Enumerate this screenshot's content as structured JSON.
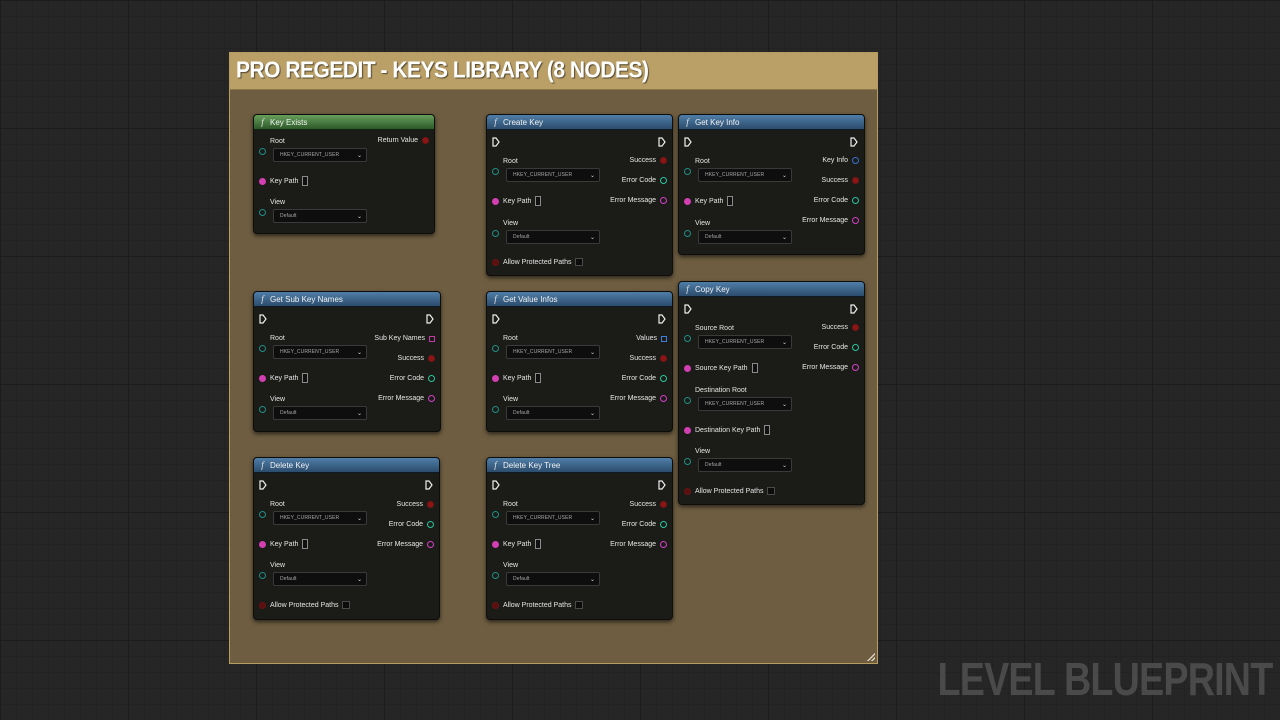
{
  "comment": {
    "title": "PRO REGEDIT - KEYS LIBRARY (8 NODES)"
  },
  "watermark": "LEVEL BLUEPRINT",
  "colors": {
    "comment_bg": "#6e5d41",
    "comment_header": "#ba9f67",
    "function_header": "#3d6a94",
    "pure_function_header": "#4f8a45",
    "node_body": "#1b1b18"
  },
  "common": {
    "root_value": "HKEY_CURRENT_USER",
    "view_value": "Default",
    "fn_icon": "f"
  },
  "nodes": {
    "key_exists": {
      "title": "Key Exists",
      "root": "Root",
      "key_path": "Key Path",
      "view": "View",
      "return_value": "Return Value"
    },
    "create_key": {
      "title": "Create Key",
      "root": "Root",
      "key_path": "Key Path",
      "view": "View",
      "allow_protected": "Allow Protected Paths",
      "success": "Success",
      "error_code": "Error Code",
      "error_message": "Error Message"
    },
    "get_key_info": {
      "title": "Get Key Info",
      "root": "Root",
      "key_path": "Key Path",
      "view": "View",
      "key_info": "Key Info",
      "success": "Success",
      "error_code": "Error Code",
      "error_message": "Error Message"
    },
    "get_sub_key_names": {
      "title": "Get Sub Key Names",
      "root": "Root",
      "key_path": "Key Path",
      "view": "View",
      "sub_key_names": "Sub Key Names",
      "success": "Success",
      "error_code": "Error Code",
      "error_message": "Error Message"
    },
    "get_value_infos": {
      "title": "Get Value Infos",
      "root": "Root",
      "key_path": "Key Path",
      "view": "View",
      "values": "Values",
      "success": "Success",
      "error_code": "Error Code",
      "error_message": "Error Message"
    },
    "copy_key": {
      "title": "Copy Key",
      "source_root": "Source Root",
      "source_key_path": "Source Key Path",
      "destination_root": "Destination Root",
      "destination_key_path": "Destination Key Path",
      "view": "View",
      "allow_protected": "Allow Protected Paths",
      "success": "Success",
      "error_code": "Error Code",
      "error_message": "Error Message"
    },
    "delete_key": {
      "title": "Delete Key",
      "root": "Root",
      "key_path": "Key Path",
      "view": "View",
      "allow_protected": "Allow Protected Paths",
      "success": "Success",
      "error_code": "Error Code",
      "error_message": "Error Message"
    },
    "delete_key_tree": {
      "title": "Delete Key Tree",
      "root": "Root",
      "key_path": "Key Path",
      "view": "View",
      "allow_protected": "Allow Protected Paths",
      "success": "Success",
      "error_code": "Error Code",
      "error_message": "Error Message"
    }
  }
}
